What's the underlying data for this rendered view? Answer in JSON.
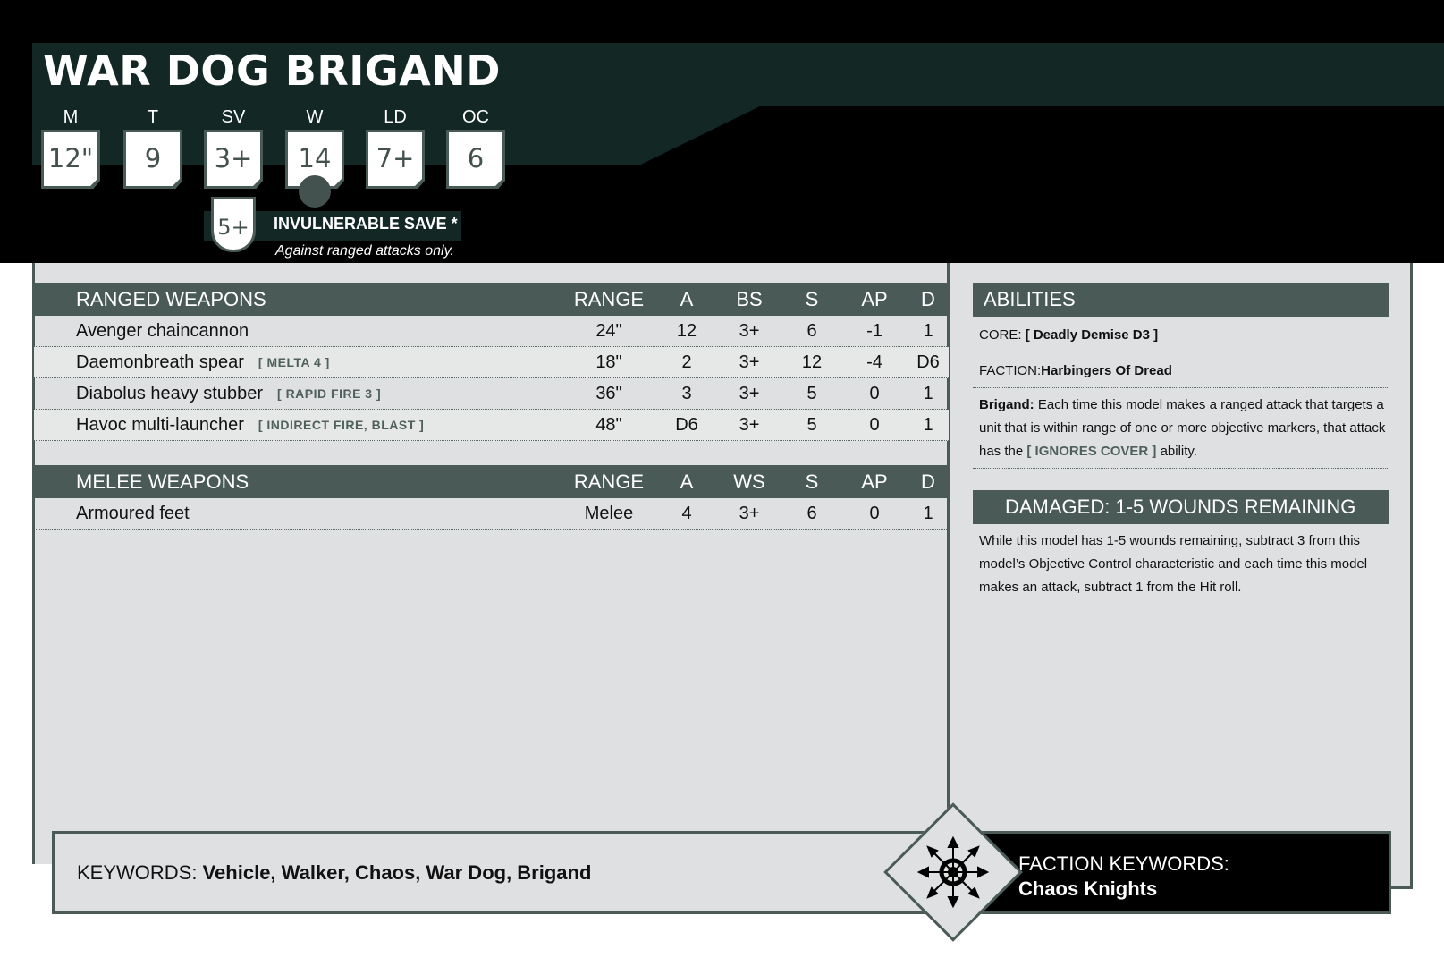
{
  "unit": {
    "name": "WAR DOG BRIGAND"
  },
  "stats": [
    {
      "label": "M",
      "value": "12\""
    },
    {
      "label": "T",
      "value": "9"
    },
    {
      "label": "SV",
      "value": "3+"
    },
    {
      "label": "W",
      "value": "14"
    },
    {
      "label": "LD",
      "value": "7+"
    },
    {
      "label": "OC",
      "value": "6"
    }
  ],
  "invuln": {
    "value": "5+",
    "label": "INVULNERABLE SAVE *",
    "note": "Against ranged attacks only."
  },
  "ranged": {
    "headers": {
      "title": "RANGED WEAPONS",
      "range": "RANGE",
      "a": "A",
      "skill": "BS",
      "s": "S",
      "ap": "AP",
      "d": "D"
    },
    "rows": [
      {
        "name": "Avenger chaincannon",
        "keywords": "",
        "range": "24\"",
        "a": "12",
        "skill": "3+",
        "s": "6",
        "ap": "-1",
        "d": "1"
      },
      {
        "name": "Daemonbreath spear",
        "keywords": "[ MELTA 4 ]",
        "range": "18\"",
        "a": "2",
        "skill": "3+",
        "s": "12",
        "ap": "-4",
        "d": "D6"
      },
      {
        "name": "Diabolus heavy stubber",
        "keywords": "[ RAPID FIRE 3 ]",
        "range": "36\"",
        "a": "3",
        "skill": "3+",
        "s": "5",
        "ap": "0",
        "d": "1"
      },
      {
        "name": "Havoc multi-launcher",
        "keywords": "[ INDIRECT FIRE, BLAST ]",
        "range": "48\"",
        "a": "D6",
        "skill": "3+",
        "s": "5",
        "ap": "0",
        "d": "1"
      }
    ]
  },
  "melee": {
    "headers": {
      "title": "MELEE WEAPONS",
      "range": "RANGE",
      "a": "A",
      "skill": "WS",
      "s": "S",
      "ap": "AP",
      "d": "D"
    },
    "rows": [
      {
        "name": "Armoured feet",
        "keywords": "",
        "range": "Melee",
        "a": "4",
        "skill": "3+",
        "s": "6",
        "ap": "0",
        "d": "1"
      }
    ]
  },
  "abilities": {
    "title": "ABILITIES",
    "core_label": "CORE:",
    "core_value": "[ Deadly Demise D3 ]",
    "faction_label": "FACTION:",
    "faction_value": "Harbingers Of Dread",
    "brigand_name": "Brigand:",
    "brigand_text_1": "Each time this model makes a ranged attack that targets a unit that is within range of one or more objective markers, that attack has the",
    "brigand_tag": "[ IGNORES COVER ]",
    "brigand_text_2": "ability."
  },
  "damaged": {
    "title": "DAMAGED: 1-5 WOUNDS REMAINING",
    "text": "While this model has 1-5 wounds remaining, subtract 3 from this model’s Objective Control characteristic and each time this model makes an attack, subtract 1 from the Hit roll."
  },
  "keywords": {
    "label": "KEYWORDS:",
    "value": "Vehicle, Walker, Chaos, War Dog, Brigand"
  },
  "faction_keywords": {
    "label": "FACTION KEYWORDS:",
    "value": "Chaos Knights"
  },
  "icons": {
    "faction": "chaos-star-icon"
  },
  "colors": {
    "header": "#132725",
    "accent": "#4a5a57",
    "panel": "#dfe0e2"
  }
}
